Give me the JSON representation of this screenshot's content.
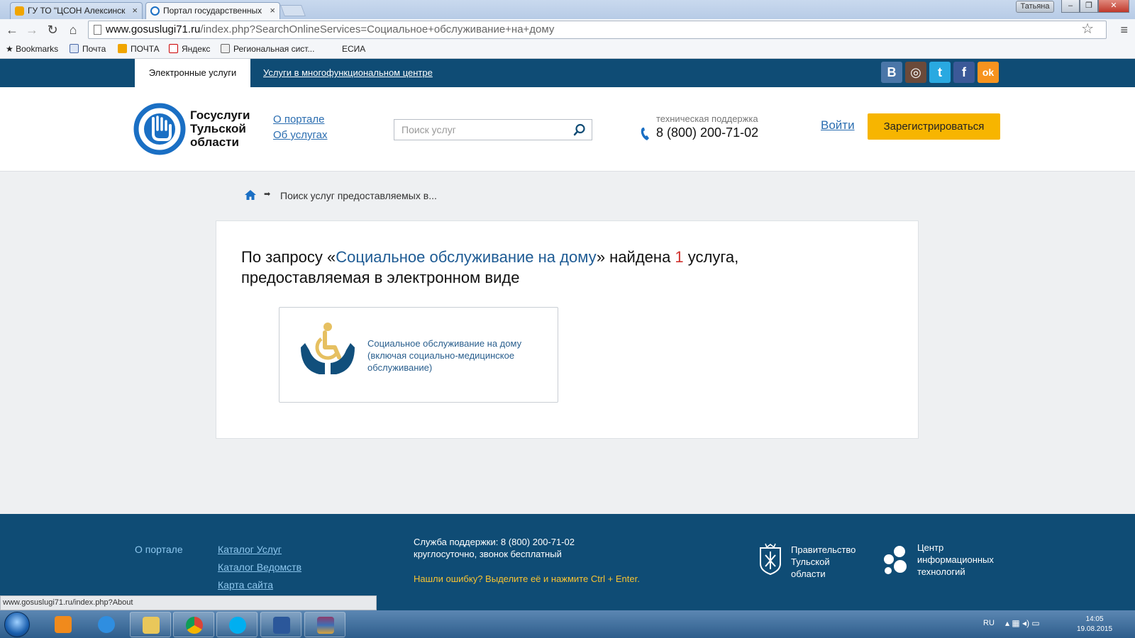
{
  "browser": {
    "tabs": [
      {
        "label": "ГУ ТО \"ЦСОН Алексинск",
        "active": false
      },
      {
        "label": "Портал государственных",
        "active": true
      }
    ],
    "user_name": "Татьяна",
    "url_host": "www.gosuslugi71.ru",
    "url_path": "/index.php?SearchOnlineServices=Социальное+обслуживание+на+дому",
    "bookmarks": [
      "Bookmarks",
      "Почта",
      "ПОЧТА",
      "Яндекс",
      "Региональная сист...",
      "ЕСИА"
    ],
    "status_url": "www.gosuslugi71.ru/index.php?About"
  },
  "sitebar": {
    "tab_active": "Электронные услуги",
    "tab_link": "Услуги в многофункциональном центре",
    "social": [
      {
        "icon": "vk-icon",
        "glyph": "B",
        "color": "#4a76a8"
      },
      {
        "icon": "instagram-icon",
        "glyph": "◎",
        "color": "#6b4a3a"
      },
      {
        "icon": "twitter-icon",
        "glyph": "t",
        "color": "#29a9e1"
      },
      {
        "icon": "facebook-icon",
        "glyph": "f",
        "color": "#3b5998"
      },
      {
        "icon": "odnoklassniki-icon",
        "glyph": "ok",
        "color": "#f7931e"
      }
    ]
  },
  "header": {
    "logo_line1": "Госуслуги",
    "logo_line2": "Тульской",
    "logo_line3": "области",
    "link_about": "О портале",
    "link_services": "Об услугах",
    "search_placeholder": "Поиск услуг",
    "support_label": "техническая поддержка",
    "support_phone": "8 (800) 200-71-02",
    "login": "Войти",
    "register": "Зарегистрироваться"
  },
  "breadcrumb": {
    "current": "Поиск услуг предоставляемых в..."
  },
  "result": {
    "prefix": "По запросу «",
    "query": "Социальное обслуживание на дому",
    "middle": "» найдена ",
    "count": "1",
    "suffix_line1": " услуга,",
    "line2": "предоставляемая в электронном виде",
    "service_title": "Социальное обслуживание на дому (включая социально-медицинское обслуживание)"
  },
  "footer": {
    "about": "О портале",
    "links": [
      "Каталог Услуг",
      "Каталог Ведомств",
      "Карта сайта"
    ],
    "support_line1": "Служба поддержки: 8 (800) 200-71-02",
    "support_line2": "круглосуточно, звонок бесплатный",
    "error_hint": "Нашли ошибку? Выделите её и нажмите Ctrl + Enter.",
    "gov_line1": "Правительство",
    "gov_line2": "Тульской",
    "gov_line3": "области",
    "cit_line1": "Центр",
    "cit_line2": "информационных",
    "cit_line3": "технологий"
  },
  "taskbar": {
    "lang": "RU",
    "time": "14:05",
    "date": "19.08.2015"
  },
  "colors": {
    "brand_dark": "#0f4c75",
    "accent_yellow": "#f7b500",
    "link_blue": "#2a6db0",
    "count_red": "#d0312d"
  }
}
